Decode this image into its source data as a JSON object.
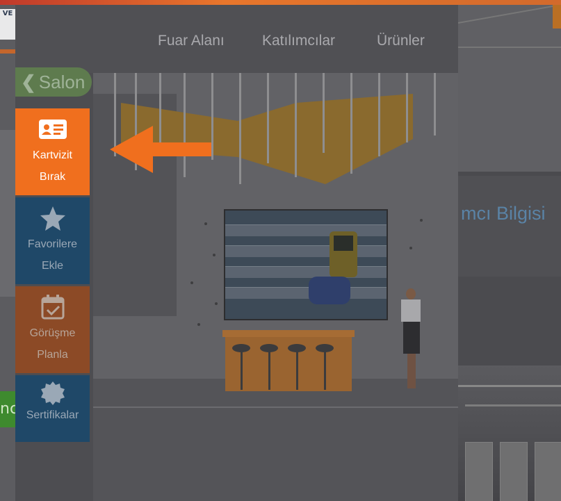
{
  "top_bar": {
    "accent": "#e8762c"
  },
  "background_left": {
    "logo_text": "VE",
    "button_text": "nc"
  },
  "background_right": {
    "info_text": "mcı Bilgisi"
  },
  "modal": {
    "nav": {
      "items": [
        "Fuar Alanı",
        "Katılımcılar",
        "Ürünler"
      ]
    },
    "back_button": {
      "label": "Salon",
      "icon": "chevron-left-icon"
    }
  },
  "sidebar": {
    "items": [
      {
        "line1": "Kartvizit",
        "line2": "Bırak",
        "icon": "business-card-icon",
        "color": "#f06f1e"
      },
      {
        "line1": "Favorilere",
        "line2": "Ekle",
        "icon": "star-icon",
        "color": "#1f4868"
      },
      {
        "line1": "Görüşme",
        "line2": "Planla",
        "icon": "calendar-check-icon",
        "color": "#8c4a26"
      },
      {
        "line1": "Sertifikalar",
        "line2": "",
        "icon": "certificate-badge-icon",
        "color": "#1f4868"
      }
    ]
  },
  "annotation": {
    "arrow_color": "#f06f1e",
    "icon": "arrow-left-icon"
  }
}
